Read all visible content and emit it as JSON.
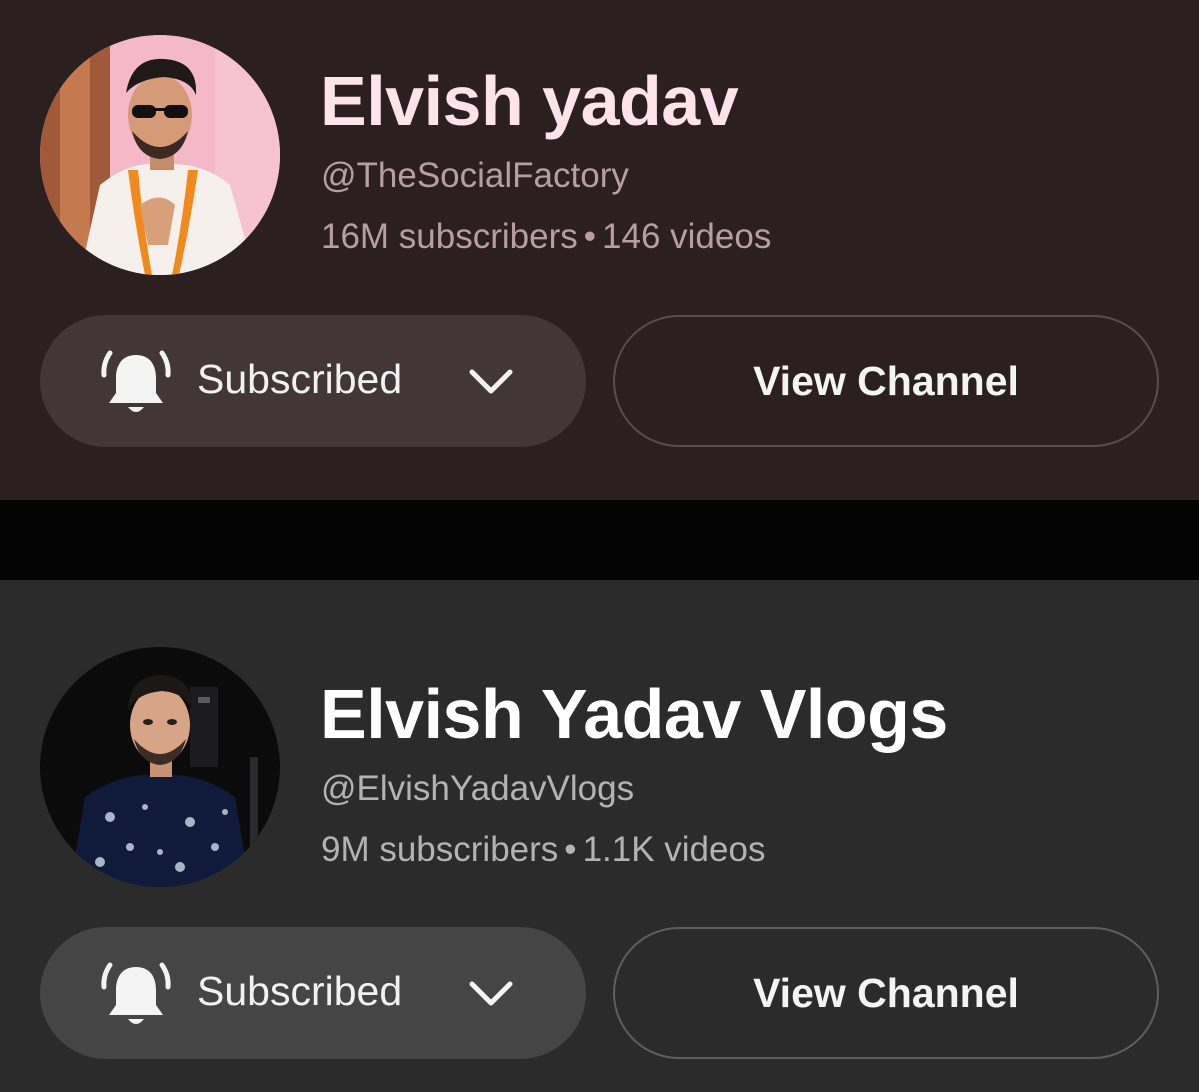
{
  "channels": [
    {
      "name": "Elvish yadav",
      "handle": "@TheSocialFactory",
      "subscribers": "16M subscribers",
      "separator": "•",
      "videos": "146 videos",
      "subscribe_label": "Subscribed",
      "view_label": "View Channel",
      "colors": {
        "background": "#2b1f20",
        "title": "#fde4ec",
        "meta": "#b89ea4",
        "subscribe_bg": "#433637",
        "view_border": "#5b4b4d"
      }
    },
    {
      "name": "Elvish Yadav Vlogs",
      "handle": "@ElvishYadavVlogs",
      "subscribers": "9M subscribers",
      "separator": "•",
      "videos": "1.1K videos",
      "subscribe_label": "Subscribed",
      "view_label": "View Channel",
      "colors": {
        "background": "#2b2b2b",
        "title": "#ffffff",
        "meta": "#b3b3b3",
        "subscribe_bg": "#454545",
        "view_border": "#5e5e5e"
      }
    }
  ],
  "icons": {
    "bell": "bell-ringing-icon",
    "chevron": "chevron-down-icon"
  }
}
